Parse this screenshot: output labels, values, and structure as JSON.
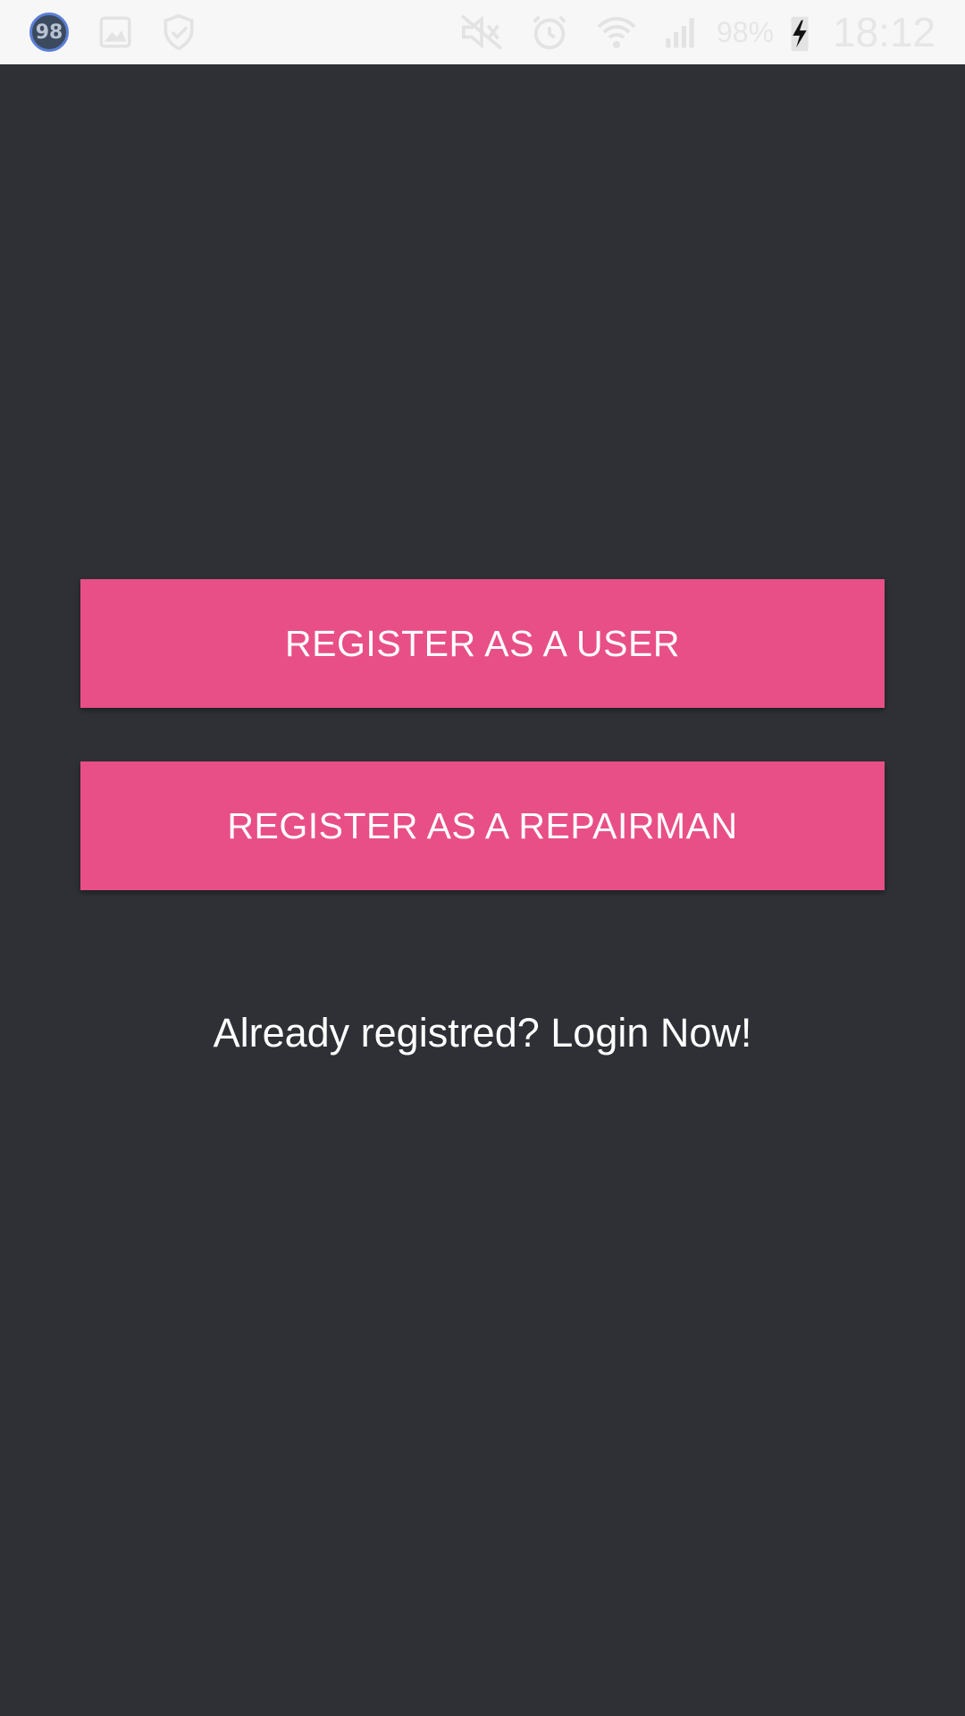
{
  "status_bar": {
    "notification_badge": "98",
    "battery_percent": "98%",
    "time": "18:12",
    "icons": [
      "notification-badge-icon",
      "image-icon",
      "shield-check-icon",
      "mute-icon",
      "alarm-icon",
      "wifi-icon",
      "signal-icon",
      "battery-charging-icon"
    ]
  },
  "screen": {
    "register_user_label": "REGISTER AS A USER",
    "register_repairman_label": "REGISTER AS A REPAIRMAN",
    "login_prompt": "Already registred? Login Now!"
  },
  "colors": {
    "background": "#2e3035",
    "button": "#e84f86",
    "status_bar": "#f7f7f7",
    "text": "#ffffff"
  }
}
